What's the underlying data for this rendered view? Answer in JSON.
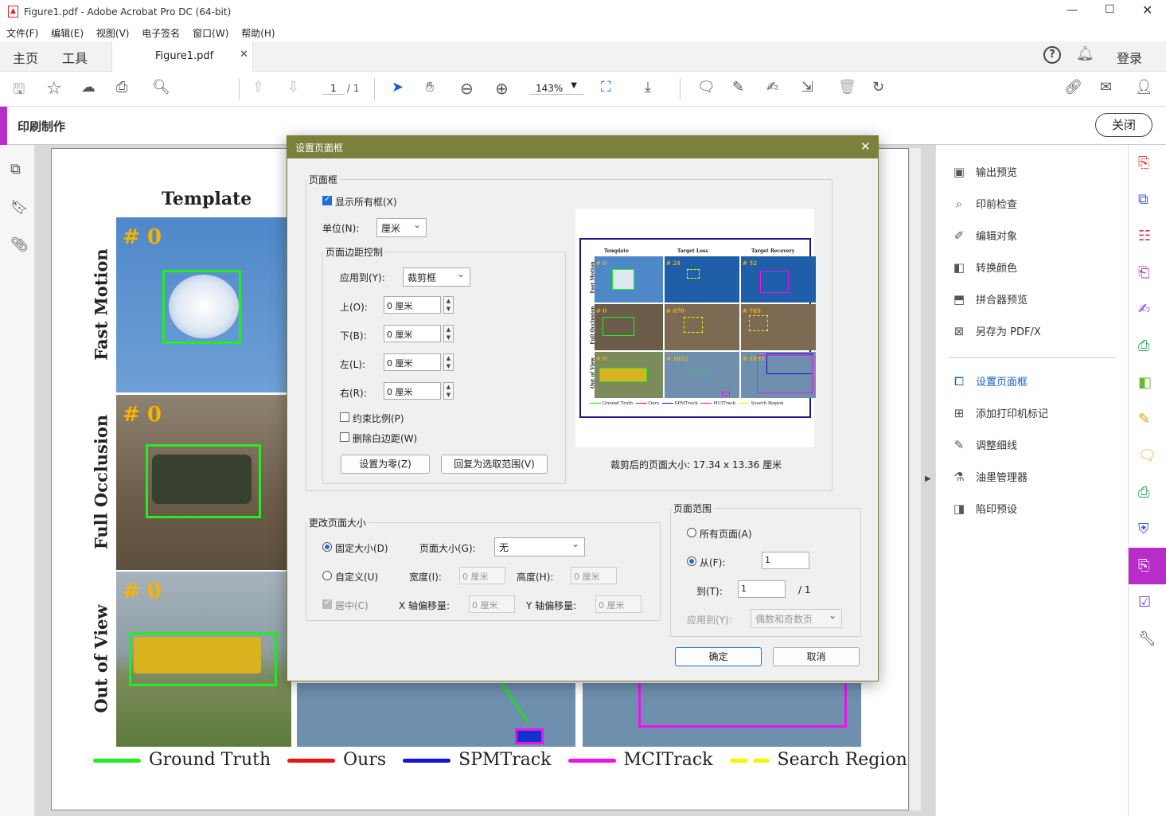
{
  "app": {
    "title": "Figure1.pdf - Adobe Acrobat Pro DC (64-bit)"
  },
  "menu": [
    "文件(F)",
    "编辑(E)",
    "视图(V)",
    "电子签名",
    "窗口(W)",
    "帮助(H)"
  ],
  "tabs": {
    "home": "主页",
    "tools": "工具",
    "doc": "Figure1.pdf",
    "login": "登录"
  },
  "toolbar": {
    "page_current": "1",
    "page_total": "/ 1",
    "zoom": "143%"
  },
  "tool": {
    "name": "印刷制作",
    "close": "关闭"
  },
  "figure": {
    "col_header": "Template",
    "rows": [
      "Fast Motion",
      "Full Occlusion",
      "Out of View"
    ],
    "frame_label": "# 0",
    "legend": [
      {
        "label": "Ground Truth",
        "color": "#22ee22"
      },
      {
        "label": "Ours",
        "color": "#ee1111"
      },
      {
        "label": "SPMTrack",
        "color": "#1111dd"
      },
      {
        "label": "MCITrack",
        "color": "#ee11ee"
      },
      {
        "label": "Search Region",
        "color": "#f5f500"
      }
    ]
  },
  "right_panel": {
    "items": [
      "输出预览",
      "印前检查",
      "编辑对象",
      "转换颜色",
      "拼合器预览",
      "另存为 PDF/X"
    ],
    "items2": [
      "设置页面框",
      "添加打印机标记",
      "调整细线",
      "油墨管理器",
      "陷印预设"
    ],
    "active": "设置页面框"
  },
  "dialog": {
    "title": "设置页面框",
    "pagebox_legend": "页面框",
    "show_all": "显示所有框(X)",
    "unit_label": "单位(N):",
    "unit_value": "厘米",
    "margin_legend": "页面边距控制",
    "apply_to_label": "应用到(Y):",
    "apply_to_value": "裁剪框",
    "top_label": "上(O):",
    "top_value": "0 厘米",
    "bottom_label": "下(B):",
    "bottom_value": "0 厘米",
    "left_label": "左(L):",
    "left_value": "0 厘米",
    "right_label": "右(R):",
    "right_value": "0 厘米",
    "constrain": "约束比例(P)",
    "remove_white": "删除白边距(W)",
    "set_zero": "设置为零(Z)",
    "revert": "回复为选取范围(V)",
    "crop_size": "裁剪后的页面大小:  17.34 x 13.36 厘米",
    "thumb_cols": [
      "Template",
      "Target Loss",
      "Target Recovery"
    ],
    "thumb_rows": [
      "Fast Motion",
      "Full Occlusion",
      "Out of View"
    ],
    "thumb_frames": [
      "# 0",
      "# 24",
      "# 52",
      "# 0",
      "# 670",
      "# 769",
      "# 0",
      "# 1852",
      "# 1895"
    ],
    "thumb_legend": [
      "Ground Truth",
      "Ours",
      "SPMTrack",
      "MCITrack",
      "Search Region"
    ],
    "thumb_out_of_view": "Out of View",
    "resize_legend": "更改页面大小",
    "fixed_size": "固定大小(D)",
    "page_size_label": "页面大小(G):",
    "page_size_value": "无",
    "custom": "自定义(U)",
    "width_label": "宽度(I):",
    "width_value": "0 厘米",
    "height_label": "高度(H):",
    "height_value": "0 厘米",
    "center": "居中(C)",
    "xoff_label": "X 轴偏移量:",
    "xoff_value": "0 厘米",
    "yoff_label": "Y 轴偏移量:",
    "yoff_value": "0 厘米",
    "range_legend": "页面范围",
    "all_pages": "所有页面(A)",
    "from": "从(F):",
    "from_value": "1",
    "to": "到(T):",
    "to_value": "1",
    "to_total": "/ 1",
    "range_apply_label": "应用到(Y):",
    "range_apply_value": "偶数和奇数页",
    "ok": "确定",
    "cancel": "取消"
  }
}
